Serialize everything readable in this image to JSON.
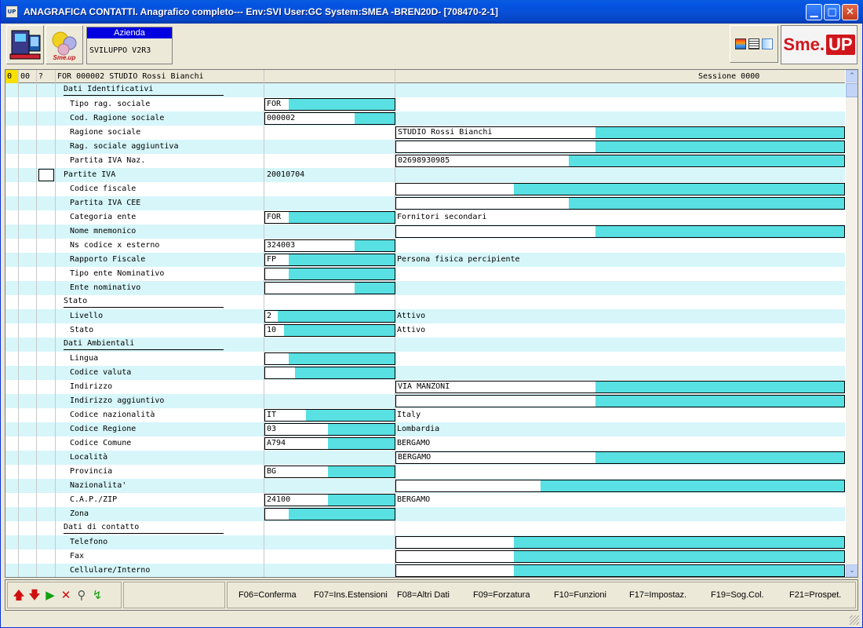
{
  "window": {
    "title": "ANAGRAFICA CONTATTI.  Anagrafico completo--- Env:SVI User:GC System:SMEA -BREN20D- [708470-2-1]",
    "app_icon": "UP",
    "minimize_icon": "minimize-icon",
    "maximize_icon": "maximize-icon",
    "close_icon": "close-icon"
  },
  "toolbar": {
    "azienda_label": "Azienda",
    "azienda_value": "SVILUPPO V2R3",
    "logo_small_text": "Sme.up",
    "logo_sme": "Sme.",
    "logo_up": "UP"
  },
  "header": {
    "col0": "0",
    "col1": "00",
    "col2": "?",
    "title": "FOR 000002 STUDIO Rossi Bianchi",
    "session": "Sessione  0000"
  },
  "rows": [
    {
      "type": "section",
      "label": "Dati Identificativi"
    },
    {
      "type": "field",
      "label": "Tipo rag. sociale",
      "value": "FOR"
    },
    {
      "type": "field",
      "label": "Cod. Ragione sociale",
      "value": "000002"
    },
    {
      "type": "field",
      "label": "Ragione sociale",
      "value": "",
      "desc": "STUDIO Rossi Bianchi"
    },
    {
      "type": "field",
      "label": "Rag. sociale aggiuntiva",
      "value": "",
      "desc": ""
    },
    {
      "type": "field",
      "label": "Partita IVA Naz.",
      "value": "",
      "desc": "02698930985"
    },
    {
      "type": "group",
      "label": "Partite IVA",
      "value": "20010704"
    },
    {
      "type": "field",
      "label": "Codice fiscale",
      "value": "",
      "desc": ""
    },
    {
      "type": "field",
      "label": "Partita IVA CEE",
      "value": "",
      "desc": ""
    },
    {
      "type": "field",
      "label": "Categoria ente",
      "value": "FOR",
      "desc": "Fornitori secondari"
    },
    {
      "type": "field",
      "label": "Nome mnemonico",
      "value": "",
      "desc": ""
    },
    {
      "type": "field",
      "label": "Ns codice x esterno",
      "value": "324003"
    },
    {
      "type": "field",
      "label": "Rapporto Fiscale",
      "value": "FP",
      "desc": "Persona fisica percipiente"
    },
    {
      "type": "field",
      "label": "Tipo ente Nominativo",
      "value": ""
    },
    {
      "type": "field",
      "label": "Ente nominativo",
      "value": ""
    },
    {
      "type": "section",
      "label": "Stato"
    },
    {
      "type": "field",
      "label": "Livello",
      "value": "2",
      "desc": "Attivo"
    },
    {
      "type": "field",
      "label": "Stato",
      "value": "10",
      "desc": "Attivo"
    },
    {
      "type": "section",
      "label": "Dati Ambientali"
    },
    {
      "type": "field",
      "label": "Lingua",
      "value": ""
    },
    {
      "type": "field",
      "label": "Codice valuta",
      "value": ""
    },
    {
      "type": "field",
      "label": "Indirizzo",
      "value": "",
      "desc": "VIA MANZONI"
    },
    {
      "type": "field",
      "label": "Indirizzo aggiuntivo",
      "value": "",
      "desc": ""
    },
    {
      "type": "field",
      "label": "Codice nazionalità",
      "value": "IT",
      "desc": "Italy"
    },
    {
      "type": "field",
      "label": "Codice Regione",
      "value": "03",
      "desc": "Lombardia"
    },
    {
      "type": "field",
      "label": "Codice Comune",
      "value": "A794",
      "desc": "BERGAMO"
    },
    {
      "type": "field",
      "label": "Località",
      "value": "",
      "desc": "BERGAMO"
    },
    {
      "type": "field",
      "label": "Provincia",
      "value": "BG"
    },
    {
      "type": "field",
      "label": "Nazionalita'",
      "value": "",
      "desc": ""
    },
    {
      "type": "field",
      "label": "C.A.P./ZIP",
      "value": "24100",
      "desc": "BERGAMO"
    },
    {
      "type": "field",
      "label": "Zona",
      "value": ""
    },
    {
      "type": "section",
      "label": "Dati di contatto"
    },
    {
      "type": "field",
      "label": "Telefono",
      "value": "",
      "desc": ""
    },
    {
      "type": "field",
      "label": "Fax",
      "value": "",
      "desc": ""
    },
    {
      "type": "field",
      "label": "Cellulare/Interno",
      "value": "",
      "desc": ""
    }
  ],
  "actions": {
    "up_icon": "red-arrow-up-icon",
    "down_icon": "red-arrow-down-icon",
    "play_icon": "green-play-icon",
    "delete_icon": "red-x-icon",
    "search_icon": "magnifier-icon",
    "refresh_icon": "green-arrow-icon"
  },
  "fkeys": [
    "F06=Conferma",
    "F07=Ins.Estensioni",
    "F08=Altri Dati",
    "F09=Forzatura",
    "F10=Funzioni",
    "F17=Impostaz.",
    "F19=Sog.Col.",
    "F21=Prospet."
  ],
  "colors": {
    "title_blue": "#0454e3",
    "row_alt": "#d6f6fa",
    "input_cyan": "#58e0e2",
    "azienda_blue": "#0000e0",
    "logo_red": "#d0161c"
  }
}
